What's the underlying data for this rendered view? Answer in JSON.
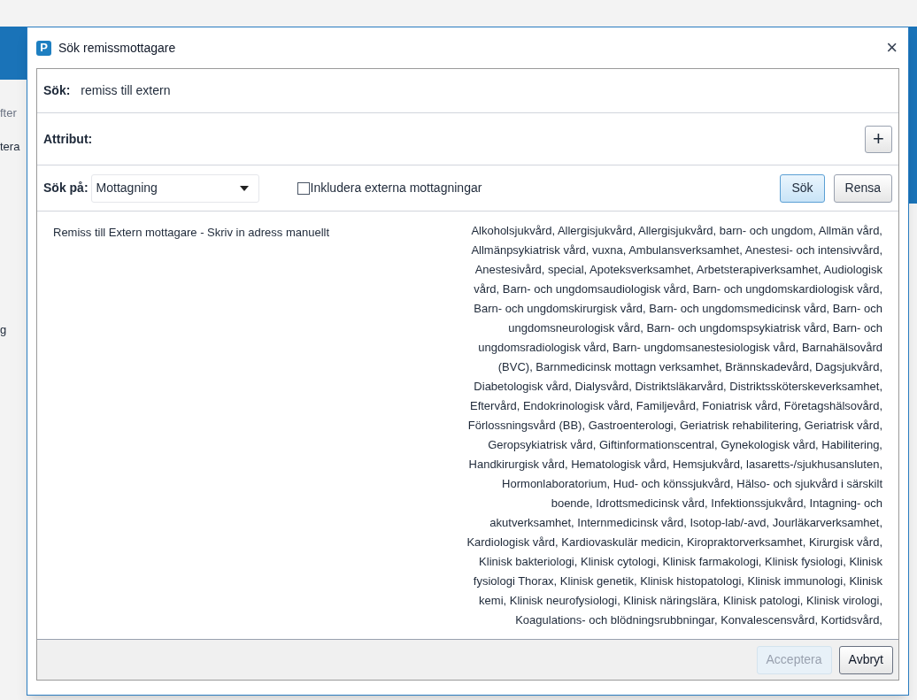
{
  "background": {
    "fragments": [
      "fter",
      "tera",
      "g"
    ]
  },
  "window": {
    "title": "Sök remissmottagare",
    "logo": "P",
    "close": "×"
  },
  "search": {
    "label": "Sök:",
    "value": "remiss till extern"
  },
  "attributes": {
    "label": "Attribut:",
    "add": "+"
  },
  "search_on": {
    "label": "Sök på:",
    "value": "Mottagning",
    "include_external": {
      "label": "Inkludera externa mottagningar",
      "checked": false
    },
    "buttons": [
      {
        "label": "Sök",
        "primary": true
      },
      {
        "label": "Rensa",
        "primary": false
      }
    ]
  },
  "results": [
    {
      "name": "Remiss till Extern mottagare - Skriv in adress manuellt",
      "description_lines": [
        "Alkoholsjukvård, Allergisjukvård, Allergisjukvård, barn- och ungdom, Allmän vård,",
        "Allmänpsykiatrisk vård, vuxna, Ambulansverksamhet, Anestesi- och intensivvård,",
        "Anestesivård, special, Apoteksverksamhet, Arbetsterapiverksamhet, Audiologisk",
        "vård, Barn- och ungdomsaudiologisk vård, Barn- och ungdomskardiologisk vård,",
        "Barn- och ungdomskirurgisk vård, Barn- och ungdomsmedicinsk vård, Barn- och",
        "ungdomsneurologisk vård, Barn- och ungdomspsykiatrisk vård, Barn- och",
        "ungdomsradiologisk vård, Barn- ungdomsanestesiologisk vård, Barnahälsovård",
        "(BVC), Barnmedicinsk mottagn verksamhet, Brännskadevård, Dagsjukvård,",
        "Diabetologisk vård, Dialysvård, Distriktsläkarvård, Distriktssköterskeverksamhet,",
        "Eftervård, Endokrinologisk vård, Familjevård, Foniatrisk vård, Företagshälsovård,",
        "Förlossningsvård (BB), Gastroenterologi, Geriatrisk rehabilitering, Geriatrisk vård,",
        "Geropsykiatrisk vård, Giftinformationscentral, Gynekologisk vård, Habilitering,",
        "Handkirurgisk vård, Hematologisk vård, Hemsjukvård, lasaretts-/sjukhusansluten,",
        "Hormonlaboratorium, Hud- och könssjukvård, Hälso- och sjukvård i särskilt",
        "boende, Idrottsmedicinsk vård, Infektionssjukvård, Intagning- och",
        "akutverksamhet, Internmedicinsk vård, Isotop-lab/-avd, Jourläkarverksamhet,",
        "Kardiologisk vård, Kardiovaskulär medicin, Kiropraktorverksamhet, Kirurgisk vård,",
        "Klinisk bakteriologi, Klinisk cytologi, Klinisk farmakologi, Klinisk fysiologi, Klinisk",
        "fysiologi Thorax, Klinisk genetik, Klinisk histopatologi, Klinisk immunologi, Klinisk",
        "kemi, Klinisk neurofysiologi, Klinisk näringslära, Klinisk patologi, Klinisk virologi,",
        "Koagulations- och blödningsrubbningar, Konvalescensvård, Kortidsvård,"
      ]
    }
  ],
  "footer": {
    "buttons": [
      {
        "label": "Acceptera",
        "disabled": true
      },
      {
        "label": "Avbryt",
        "disabled": false
      }
    ]
  }
}
